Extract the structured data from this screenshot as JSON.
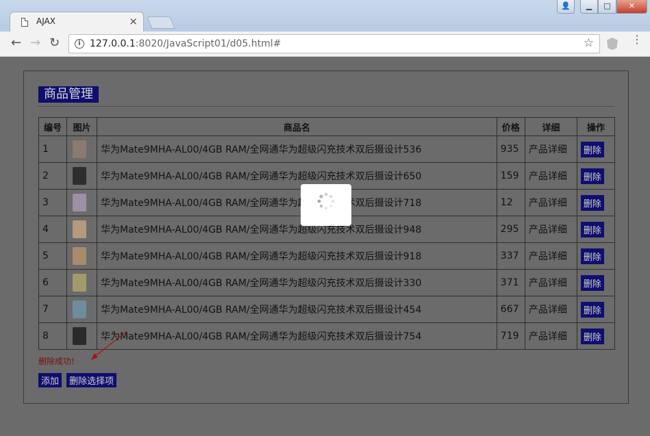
{
  "browser": {
    "tab_title": "AJAX",
    "tab_close": "×",
    "url_host": "127.0.0.1",
    "url_rest": ":8020/JavaScript01/d05.html#",
    "window_buttons": {
      "user": "👤",
      "minimize": "▁",
      "maximize": "□",
      "close": "✕"
    }
  },
  "page": {
    "panel_title": "商品管理",
    "table": {
      "headers": [
        "编号",
        "图片",
        "商品名",
        "价格",
        "详细",
        "操作"
      ],
      "rows": [
        {
          "id": "1",
          "name": "华为Mate9MHA-AL00/4GB RAM/全网通华为超级闪充技术双后摄设计536",
          "price": "935",
          "detail": "产品详细",
          "action": "删除",
          "thumb_color": "#8a7a70"
        },
        {
          "id": "2",
          "name": "华为Mate9MHA-AL00/4GB RAM/全网通华为超级闪充技术双后摄设计650",
          "price": "159",
          "detail": "产品详细",
          "action": "删除",
          "thumb_color": "#2e2e30"
        },
        {
          "id": "3",
          "name": "华为Mate9MHA-AL00/4GB RAM/全网通华为超级闪充技术双后摄设计718",
          "price": "12",
          "detail": "产品详细",
          "action": "删除",
          "thumb_color": "#9c8fa6"
        },
        {
          "id": "4",
          "name": "华为Mate9MHA-AL00/4GB RAM/全网通华为超级闪充技术双后摄设计948",
          "price": "295",
          "detail": "产品详细",
          "action": "删除",
          "thumb_color": "#b59a7e"
        },
        {
          "id": "5",
          "name": "华为Mate9MHA-AL00/4GB RAM/全网通华为超级闪充技术双后摄设计918",
          "price": "337",
          "detail": "产品详细",
          "action": "删除",
          "thumb_color": "#a98a6a"
        },
        {
          "id": "6",
          "name": "华为Mate9MHA-AL00/4GB RAM/全网通华为超级闪充技术双后摄设计330",
          "price": "371",
          "detail": "产品详细",
          "action": "删除",
          "thumb_color": "#a39a6c"
        },
        {
          "id": "7",
          "name": "华为Mate9MHA-AL00/4GB RAM/全网通华为超级闪充技术双后摄设计454",
          "price": "667",
          "detail": "产品详细",
          "action": "删除",
          "thumb_color": "#6f8c9e"
        },
        {
          "id": "8",
          "name": "华为Mate9MHA-AL00/4GB RAM/全网通华为超级闪充技术双后摄设计754",
          "price": "719",
          "detail": "产品详细",
          "action": "删除",
          "thumb_color": "#2a2a2c"
        }
      ]
    },
    "message": "删除成功!",
    "add_button": "添加",
    "delete_selected_button": "删除选择项"
  },
  "colors": {
    "overlay_bg": "#6b6b6b",
    "button_bg": "#0f0f6e",
    "message_color": "#7a1010",
    "arrow_color": "#b01010"
  }
}
